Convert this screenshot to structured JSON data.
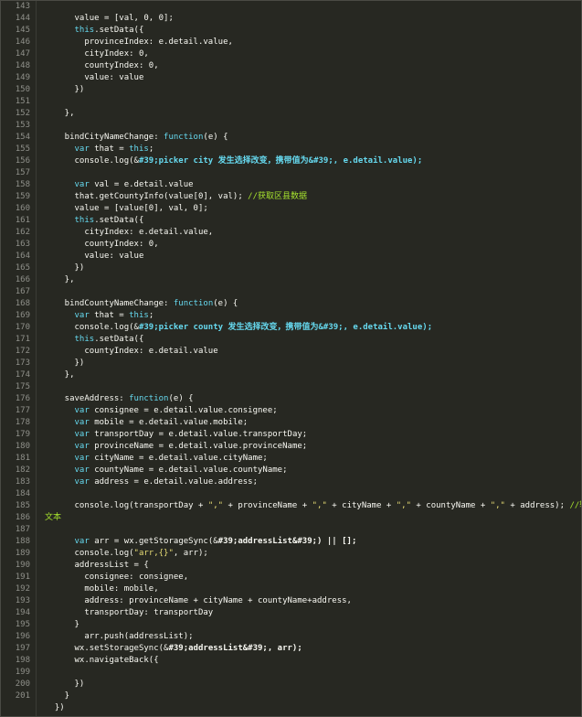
{
  "lines": [
    {
      "n": "143",
      "seg": []
    },
    {
      "n": "144",
      "seg": [
        [
          "",
          "      value = [val, 0, 0];"
        ]
      ]
    },
    {
      "n": "145",
      "seg": [
        [
          "kw",
          "      this"
        ],
        [
          "",
          ".setData({"
        ]
      ]
    },
    {
      "n": "146",
      "seg": [
        [
          "",
          "        provinceIndex: e.detail.value,"
        ]
      ]
    },
    {
      "n": "147",
      "seg": [
        [
          "",
          "        cityIndex: 0,"
        ]
      ]
    },
    {
      "n": "148",
      "seg": [
        [
          "",
          "        countyIndex: 0,"
        ]
      ]
    },
    {
      "n": "149",
      "seg": [
        [
          "",
          "        value: value"
        ]
      ]
    },
    {
      "n": "150",
      "seg": [
        [
          "",
          "      })"
        ]
      ]
    },
    {
      "n": "151",
      "seg": []
    },
    {
      "n": "152",
      "seg": [
        [
          "",
          "    },"
        ]
      ]
    },
    {
      "n": "153",
      "seg": []
    },
    {
      "n": "154",
      "seg": [
        [
          "",
          "    bindCityNameChange: "
        ],
        [
          "kw",
          "function"
        ],
        [
          "",
          "(e) {"
        ]
      ]
    },
    {
      "n": "155",
      "seg": [
        [
          "kw",
          "      var"
        ],
        [
          "",
          " that = "
        ],
        [
          "kw",
          "this"
        ],
        [
          "",
          ";"
        ]
      ]
    },
    {
      "n": "156",
      "seg": [
        [
          "",
          "      console.log(&"
        ],
        [
          "hl",
          "#39;picker city 发生选择改变，携带值为&#39;, e.detail.value);"
        ]
      ]
    },
    {
      "n": "157",
      "seg": []
    },
    {
      "n": "158",
      "seg": [
        [
          "kw",
          "      var"
        ],
        [
          "",
          " val = e.detail.value"
        ]
      ]
    },
    {
      "n": "159",
      "seg": [
        [
          "",
          "      that.getCountyInfo(value[0], val); "
        ],
        [
          "cm",
          "//获取区县数据"
        ]
      ]
    },
    {
      "n": "160",
      "seg": [
        [
          "",
          "      value = [value[0], val, 0];"
        ]
      ]
    },
    {
      "n": "161",
      "seg": [
        [
          "kw",
          "      this"
        ],
        [
          "",
          ".setData({"
        ]
      ]
    },
    {
      "n": "162",
      "seg": [
        [
          "",
          "        cityIndex: e.detail.value,"
        ]
      ]
    },
    {
      "n": "163",
      "seg": [
        [
          "",
          "        countyIndex: 0,"
        ]
      ]
    },
    {
      "n": "164",
      "seg": [
        [
          "",
          "        value: value"
        ]
      ]
    },
    {
      "n": "165",
      "seg": [
        [
          "",
          "      })"
        ]
      ]
    },
    {
      "n": "166",
      "seg": [
        [
          "",
          "    },"
        ]
      ]
    },
    {
      "n": "167",
      "seg": []
    },
    {
      "n": "168",
      "seg": [
        [
          "",
          "    bindCountyNameChange: "
        ],
        [
          "kw",
          "function"
        ],
        [
          "",
          "(e) {"
        ]
      ]
    },
    {
      "n": "169",
      "seg": [
        [
          "kw",
          "      var"
        ],
        [
          "",
          " that = "
        ],
        [
          "kw",
          "this"
        ],
        [
          "",
          ";"
        ]
      ]
    },
    {
      "n": "170",
      "seg": [
        [
          "",
          "      console.log(&"
        ],
        [
          "hl",
          "#39;picker county 发生选择改变，携带值为&#39;, e.detail.value);"
        ]
      ]
    },
    {
      "n": "171",
      "seg": [
        [
          "kw",
          "      this"
        ],
        [
          "",
          ".setData({"
        ]
      ]
    },
    {
      "n": "172",
      "seg": [
        [
          "",
          "        countyIndex: e.detail.value"
        ]
      ]
    },
    {
      "n": "173",
      "seg": [
        [
          "",
          "      })"
        ]
      ]
    },
    {
      "n": "174",
      "seg": [
        [
          "",
          "    },"
        ]
      ]
    },
    {
      "n": "175",
      "seg": []
    },
    {
      "n": "176",
      "seg": [
        [
          "",
          "    saveAddress: "
        ],
        [
          "kw",
          "function"
        ],
        [
          "",
          "(e) {"
        ]
      ]
    },
    {
      "n": "177",
      "seg": [
        [
          "kw",
          "      var"
        ],
        [
          "",
          " consignee = e.detail.value.consignee;"
        ]
      ]
    },
    {
      "n": "178",
      "seg": [
        [
          "kw",
          "      var"
        ],
        [
          "",
          " mobile = e.detail.value.mobile;"
        ]
      ]
    },
    {
      "n": "179",
      "seg": [
        [
          "kw",
          "      var"
        ],
        [
          "",
          " transportDay = e.detail.value.transportDay;"
        ]
      ]
    },
    {
      "n": "180",
      "seg": [
        [
          "kw",
          "      var"
        ],
        [
          "",
          " provinceName = e.detail.value.provinceName;"
        ]
      ]
    },
    {
      "n": "181",
      "seg": [
        [
          "kw",
          "      var"
        ],
        [
          "",
          " cityName = e.detail.value.cityName;"
        ]
      ]
    },
    {
      "n": "182",
      "seg": [
        [
          "kw",
          "      var"
        ],
        [
          "",
          " countyName = e.detail.value.countyName;"
        ]
      ]
    },
    {
      "n": "183",
      "seg": [
        [
          "kw",
          "      var"
        ],
        [
          "",
          " address = e.detail.value.address;"
        ]
      ]
    },
    {
      "n": "184",
      "seg": []
    },
    {
      "n": "185",
      "seg": [
        [
          "",
          "      console.log(transportDay + "
        ],
        [
          "str",
          "\",\""
        ],
        [
          "",
          " + provinceName + "
        ],
        [
          "str",
          "\",\""
        ],
        [
          "",
          " + cityName + "
        ],
        [
          "str",
          "\",\""
        ],
        [
          "",
          " + countyName + "
        ],
        [
          "str",
          "\",\""
        ],
        [
          "",
          " + address); "
        ],
        [
          "cm",
          "//输出该"
        ]
      ]
    },
    {
      "n": "186",
      "seg": [
        [
          "cm",
          "文本"
        ]
      ]
    },
    {
      "n": "187",
      "seg": []
    },
    {
      "n": "188",
      "seg": [
        [
          "kw",
          "      var"
        ],
        [
          "",
          " arr = wx.getStorageSync(&"
        ],
        [
          "bold",
          "#39;addressList&#39;) || [];"
        ]
      ]
    },
    {
      "n": "189",
      "seg": [
        [
          "",
          "      console.log("
        ],
        [
          "str",
          "\"arr,{}\""
        ],
        [
          "",
          ", arr);"
        ]
      ]
    },
    {
      "n": "190",
      "seg": [
        [
          "",
          "      addressList = {"
        ]
      ]
    },
    {
      "n": "191",
      "seg": [
        [
          "",
          "        consignee: consignee,"
        ]
      ]
    },
    {
      "n": "192",
      "seg": [
        [
          "",
          "        mobile: mobile,"
        ]
      ]
    },
    {
      "n": "193",
      "seg": [
        [
          "",
          "        address: provinceName + cityName + countyName+address,"
        ]
      ]
    },
    {
      "n": "194",
      "seg": [
        [
          "",
          "        transportDay: transportDay"
        ]
      ]
    },
    {
      "n": "195",
      "seg": [
        [
          "",
          "      }"
        ]
      ]
    },
    {
      "n": "196",
      "seg": [
        [
          "",
          "        arr.push(addressList);"
        ]
      ]
    },
    {
      "n": "197",
      "seg": [
        [
          "",
          "      wx.setStorageSync(&"
        ],
        [
          "bold",
          "#39;addressList&#39;, arr);"
        ]
      ]
    },
    {
      "n": "198",
      "seg": [
        [
          "",
          "      wx.navigateBack({"
        ]
      ]
    },
    {
      "n": "199",
      "seg": []
    },
    {
      "n": "200",
      "seg": [
        [
          "",
          "      })"
        ]
      ]
    },
    {
      "n": "201",
      "seg": [
        [
          "",
          "    }"
        ]
      ]
    },
    {
      "n": "",
      "seg": [
        [
          "",
          "  })"
        ]
      ]
    }
  ]
}
